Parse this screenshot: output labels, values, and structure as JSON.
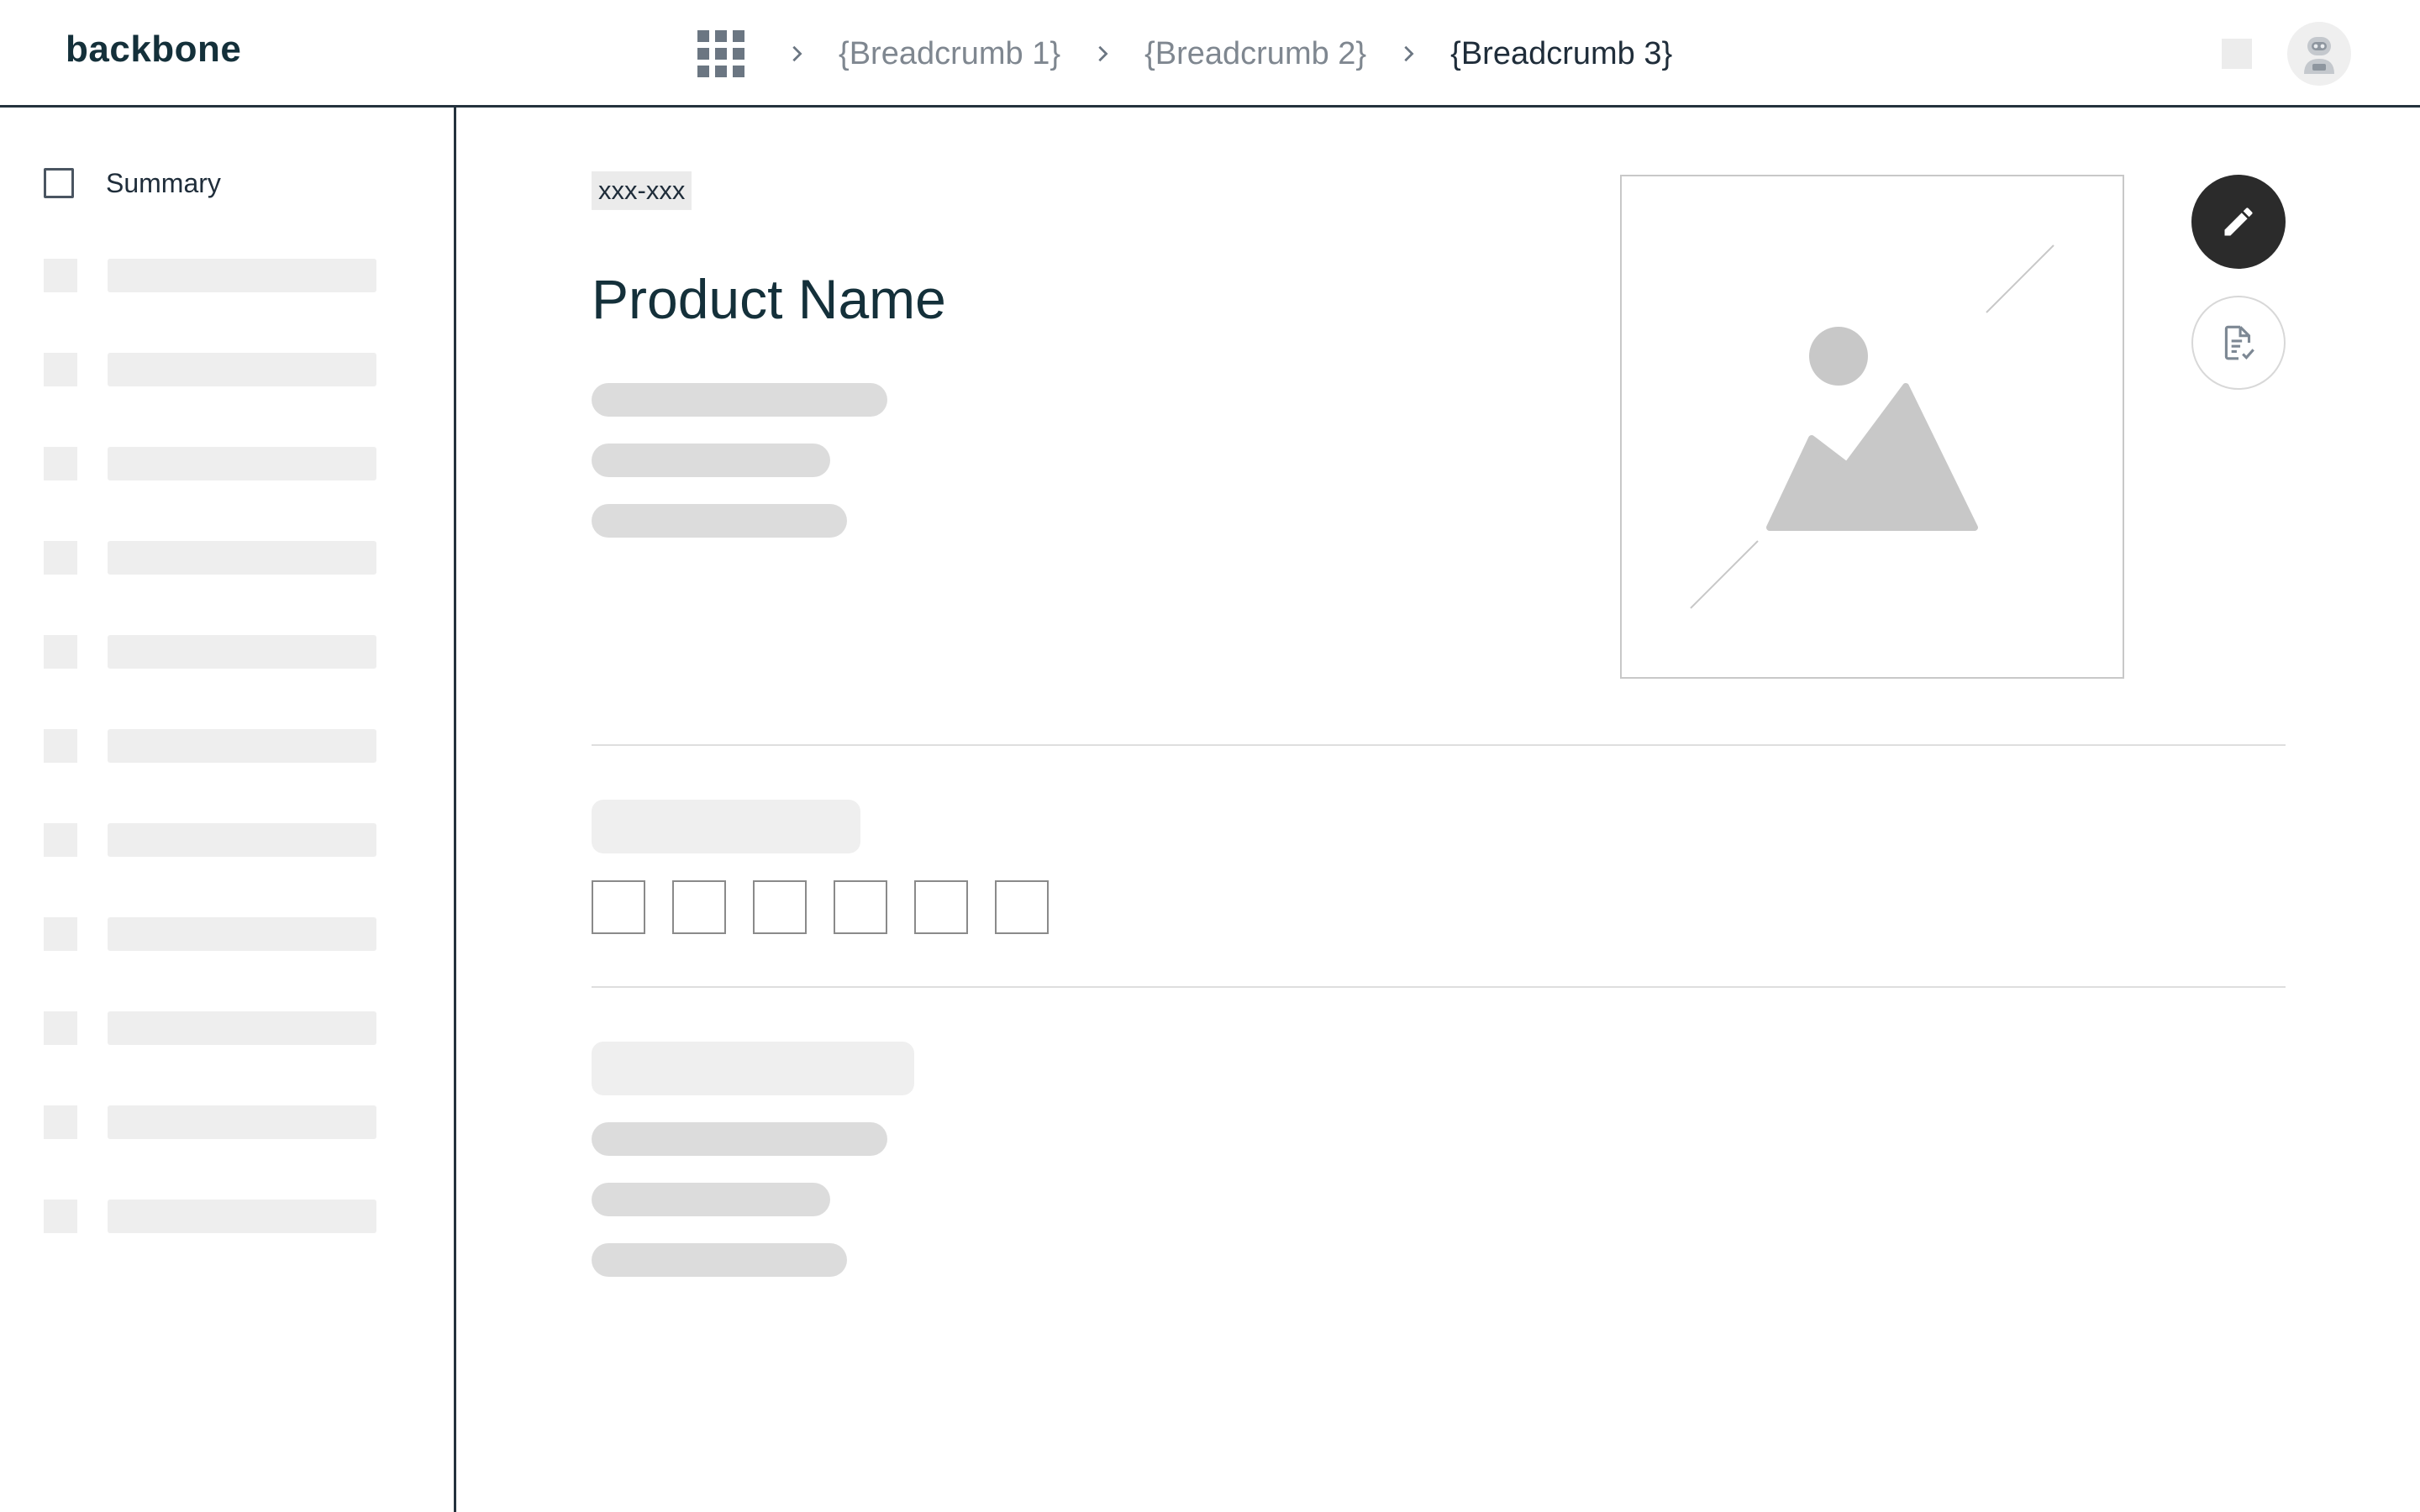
{
  "header": {
    "logo": "backbone",
    "breadcrumbs": [
      {
        "label": "{Breadcrumb 1}"
      },
      {
        "label": "{Breadcrumb 2}"
      },
      {
        "label": "{Breadcrumb 3}"
      }
    ],
    "icons": {
      "apps": "apps-grid-icon",
      "separator": "chevron-right-icon",
      "avatar": "robot-avatar-icon"
    }
  },
  "sidebar": {
    "summary_label": "Summary",
    "placeholder_item_count": 11
  },
  "main": {
    "sku": "xxx-xxx",
    "product_name": "Product Name",
    "image_placeholder_icon": "image-placeholder-icon",
    "actions": {
      "edit_icon": "pencil-icon",
      "review_icon": "document-check-icon"
    },
    "swatch_count": 6
  },
  "colors": {
    "accent_dark": "#2b2b2b",
    "border_dark": "#24323d",
    "skeleton": "#dcdcdc",
    "skeleton_light": "#eeeeee",
    "muted_text": "#7f8790"
  }
}
